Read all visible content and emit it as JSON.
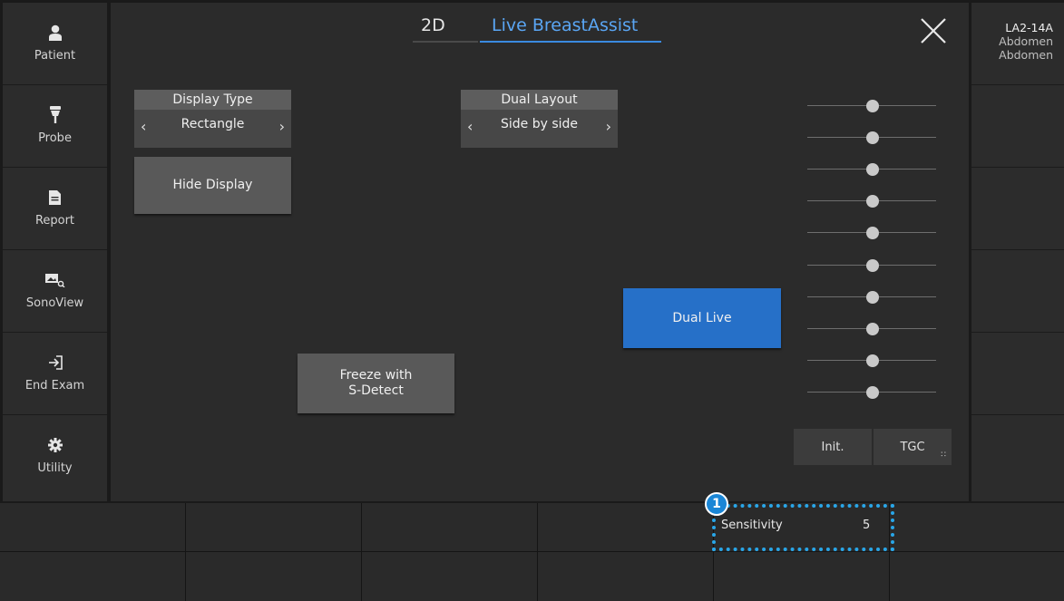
{
  "sidebar": {
    "items": [
      {
        "label": "Patient",
        "icon": "patient-icon"
      },
      {
        "label": "Probe",
        "icon": "probe-icon"
      },
      {
        "label": "Report",
        "icon": "report-icon"
      },
      {
        "label": "SonoView",
        "icon": "sonoview-icon"
      },
      {
        "label": "End Exam",
        "icon": "end-exam-icon"
      },
      {
        "label": "Utility",
        "icon": "gear-icon"
      }
    ]
  },
  "tabs": {
    "mode": "2D",
    "active": "Live BreastAssist"
  },
  "probe_info": {
    "probe": "LA2-14A",
    "line2": "Abdomen",
    "line3": "Abdomen"
  },
  "controls": {
    "display_type": {
      "title": "Display Type",
      "value": "Rectangle"
    },
    "dual_layout": {
      "title": "Dual Layout",
      "value": "Side by side"
    },
    "hide_display": "Hide Display",
    "dual_live": "Dual Live",
    "freeze_line1": "Freeze with",
    "freeze_line2": "S-Detect",
    "init": "Init.",
    "tgc": "TGC"
  },
  "tgc_slider_count": 10,
  "softkeys": {
    "sensitivity_label": "Sensitivity",
    "sensitivity_value": "5"
  },
  "annotation": {
    "badge": "1",
    "color": "#29a6e8"
  },
  "colors": {
    "accent_blue": "#2670c8",
    "tab_active": "#5aa6f4",
    "background": "#2b2b2b"
  }
}
